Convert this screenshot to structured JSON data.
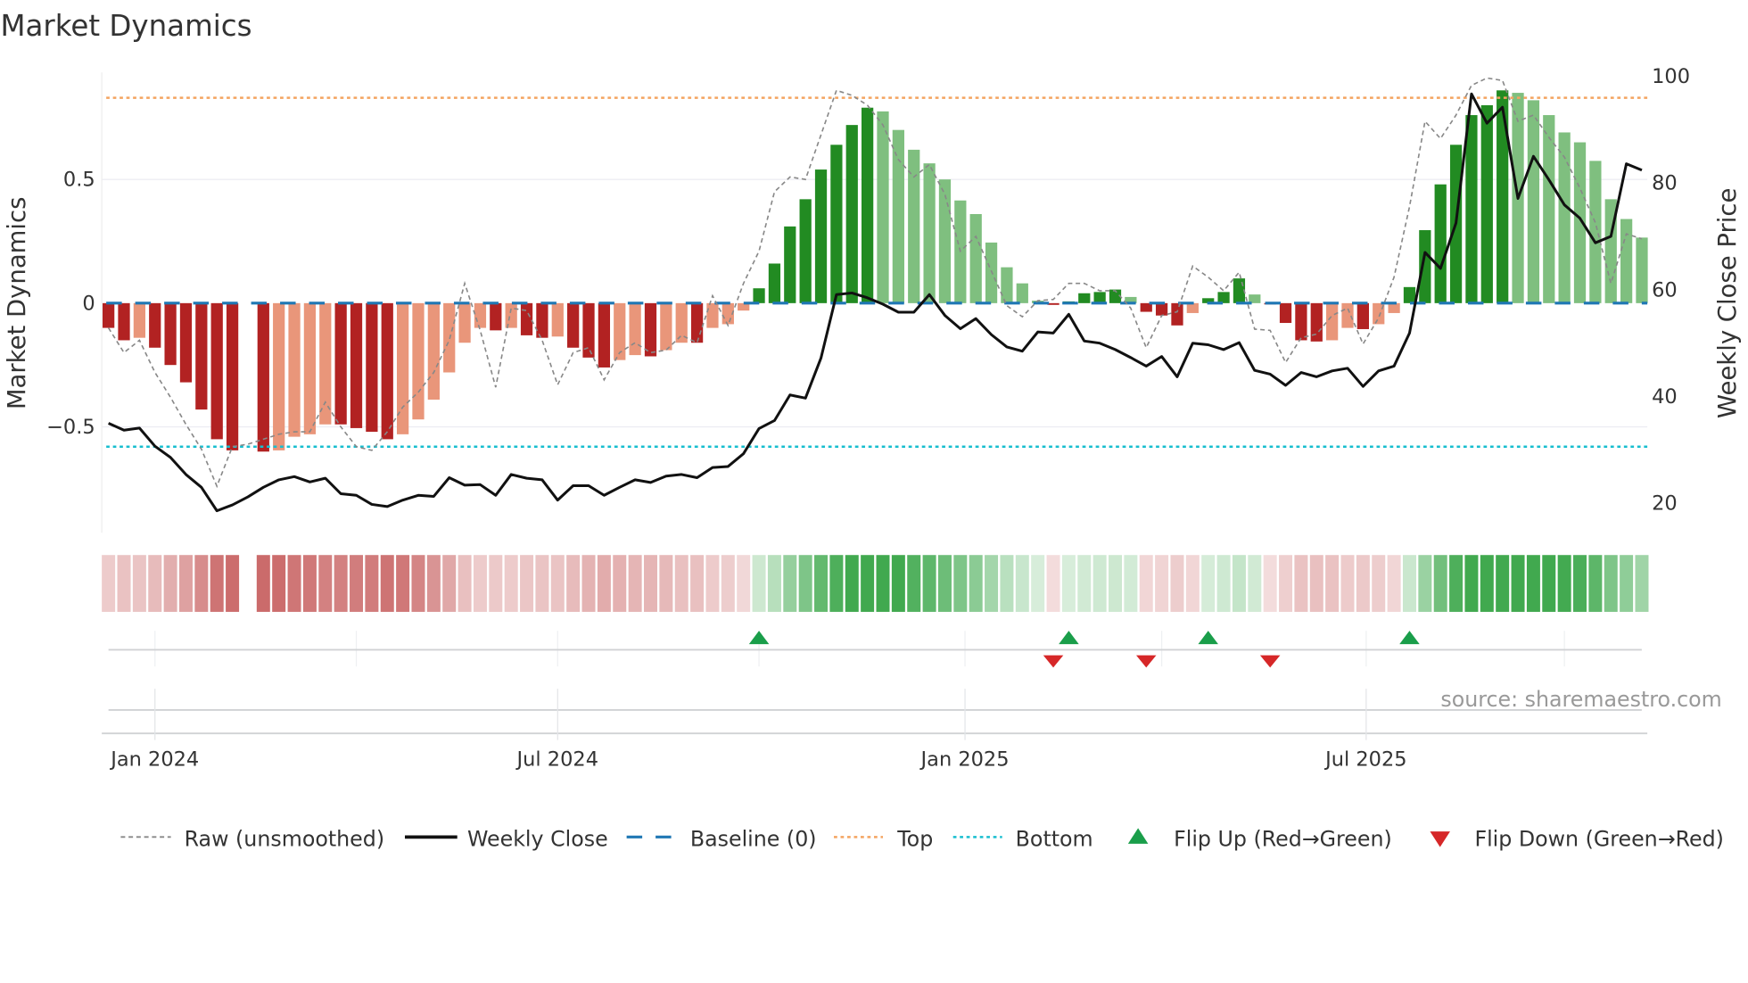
{
  "chart_data": {
    "type": "bar",
    "title": "Market Dynamics",
    "ylabel": "Market Dynamics",
    "y2label": "Weekly Close Price",
    "ylim": [
      -0.93,
      0.93
    ],
    "y2lim": [
      16,
      104
    ],
    "yticks": [
      {
        "v": 0.5,
        "label": "0.5"
      },
      {
        "v": 0,
        "label": "0"
      },
      {
        "v": -0.5,
        "label": "−0.5"
      }
    ],
    "y2ticks": [
      {
        "v": 100,
        "label": "100"
      },
      {
        "v": 80,
        "label": "80"
      },
      {
        "v": 60,
        "label": "60"
      },
      {
        "v": 40,
        "label": "40"
      },
      {
        "v": 20,
        "label": "20"
      }
    ],
    "xticks": [
      {
        "week": 3,
        "label": "Jan 2024"
      },
      {
        "week": 29,
        "label": "Jul 2024"
      },
      {
        "week": 55.3,
        "label": "Jan 2025"
      },
      {
        "week": 81.2,
        "label": "Jul 2025"
      }
    ],
    "minor_xticks": [
      16,
      42,
      68,
      94
    ],
    "weeks": 100,
    "top_level": 0.83,
    "bottom_level": -0.58,
    "baseline": 0,
    "colors": {
      "dark_red": "#b22222",
      "light_red": "#e9967a",
      "dark_green": "#228b22",
      "light_green": "#7fbf7f",
      "raw": "#888888",
      "close": "#111111",
      "baseline": "#1f77b4",
      "top": "#f4a460",
      "bottom": "#17becf",
      "flip_up": "#1a9e4a",
      "flip_down": "#d62728"
    },
    "dynamics": [
      -0.1,
      -0.15,
      -0.14,
      -0.18,
      -0.25,
      -0.32,
      -0.43,
      -0.55,
      -0.595,
      null,
      -0.6,
      -0.595,
      -0.54,
      -0.53,
      -0.49,
      -0.49,
      -0.505,
      -0.52,
      -0.55,
      -0.53,
      -0.47,
      -0.39,
      -0.28,
      -0.16,
      -0.1,
      -0.11,
      -0.1,
      -0.13,
      -0.14,
      -0.135,
      -0.18,
      -0.22,
      -0.26,
      -0.23,
      -0.21,
      -0.215,
      -0.19,
      -0.16,
      -0.16,
      -0.1,
      -0.085,
      -0.03,
      0.06,
      0.16,
      0.31,
      0.42,
      0.54,
      0.64,
      0.72,
      0.79,
      0.775,
      0.7,
      0.62,
      0.565,
      0.5,
      0.415,
      0.36,
      0.245,
      0.145,
      0.08,
      0.01,
      -0.007,
      0.007,
      0.04,
      0.045,
      0.055,
      0.025,
      -0.035,
      -0.05,
      -0.09,
      -0.04,
      0.02,
      0.045,
      0.1,
      0.035,
      -0.005,
      -0.08,
      -0.15,
      -0.155,
      -0.15,
      -0.1,
      -0.105,
      -0.085,
      -0.04,
      0.065,
      0.295,
      0.48,
      0.64,
      0.76,
      0.8,
      0.86,
      0.85,
      0.82,
      0.76,
      0.69,
      0.65,
      0.575,
      0.42,
      0.34,
      0.265
    ],
    "strength": [
      "strong",
      "strong",
      "weak",
      "strong",
      "strong",
      "strong",
      "strong",
      "strong",
      "strong",
      null,
      "strong",
      "weak",
      "weak",
      "weak",
      "weak",
      "strong",
      "strong",
      "strong",
      "strong",
      "weak",
      "weak",
      "weak",
      "weak",
      "weak",
      "weak",
      "strong",
      "weak",
      "strong",
      "strong",
      "weak",
      "strong",
      "strong",
      "strong",
      "weak",
      "weak",
      "strong",
      "weak",
      "weak",
      "strong",
      "weak",
      "weak",
      "weak",
      "strong",
      "strong",
      "strong",
      "strong",
      "strong",
      "strong",
      "strong",
      "strong",
      "weak",
      "weak",
      "weak",
      "weak",
      "weak",
      "weak",
      "weak",
      "weak",
      "weak",
      "weak",
      "weak",
      "strong",
      "strong",
      "strong",
      "strong",
      "strong",
      "weak",
      "strong",
      "strong",
      "strong",
      "weak",
      "strong",
      "strong",
      "strong",
      "weak",
      "strong",
      "strong",
      "strong",
      "strong",
      "weak",
      "weak",
      "strong",
      "weak",
      "weak",
      "strong",
      "strong",
      "strong",
      "strong",
      "strong",
      "strong",
      "strong",
      "weak",
      "weak",
      "weak",
      "weak",
      "weak",
      "weak",
      "weak",
      "weak",
      "weak"
    ],
    "weekly_close": [
      35.0,
      33.7,
      34.1,
      30.7,
      28.6,
      25.4,
      23.0,
      18.6,
      19.7,
      21.2,
      23.0,
      24.4,
      25.0,
      24.0,
      24.7,
      21.8,
      21.5,
      19.8,
      19.4,
      20.6,
      21.5,
      21.3,
      24.8,
      23.4,
      23.5,
      21.5,
      25.4,
      24.7,
      24.4,
      20.6,
      23.3,
      23.3,
      21.5,
      23.0,
      24.4,
      23.9,
      25.1,
      25.4,
      24.8,
      26.7,
      26.9,
      29.3,
      34.0,
      35.5,
      40.3,
      39.7,
      47.2,
      59.1,
      59.4,
      58.5,
      57.3,
      55.8,
      55.8,
      59.1,
      55.2,
      52.7,
      54.6,
      51.6,
      49.3,
      48.5,
      52.1,
      51.9,
      55.4,
      50.4,
      50.0,
      48.8,
      47.3,
      45.7,
      47.5,
      43.7,
      50.0,
      49.7,
      48.8,
      50.1,
      44.9,
      44.2,
      42.1,
      44.5,
      43.7,
      44.8,
      45.3,
      41.9,
      44.8,
      45.7,
      51.9,
      67.0,
      64.0,
      72.5,
      96.7,
      91.2,
      94.2,
      77.1,
      85.0,
      80.6,
      75.9,
      73.4,
      68.8,
      70.0,
      83.6,
      82.4
    ],
    "raw": [
      -0.1,
      -0.2,
      -0.15,
      -0.28,
      -0.38,
      -0.49,
      -0.59,
      -0.74,
      -0.58,
      -0.57,
      -0.55,
      -0.53,
      -0.52,
      -0.52,
      -0.4,
      -0.5,
      -0.58,
      -0.595,
      -0.52,
      -0.42,
      -0.36,
      -0.28,
      -0.15,
      0.08,
      -0.11,
      -0.34,
      -0.02,
      -0.03,
      -0.15,
      -0.33,
      -0.2,
      -0.18,
      -0.31,
      -0.2,
      -0.16,
      -0.2,
      -0.19,
      -0.13,
      -0.16,
      0.03,
      -0.09,
      0.08,
      0.21,
      0.45,
      0.51,
      0.5,
      0.68,
      0.86,
      0.84,
      0.8,
      0.72,
      0.58,
      0.51,
      0.56,
      0.44,
      0.21,
      0.27,
      0.13,
      -0.01,
      -0.055,
      0.01,
      0.015,
      0.08,
      0.08,
      0.05,
      0.05,
      -0.02,
      -0.18,
      -0.05,
      -0.035,
      0.15,
      0.105,
      0.05,
      0.125,
      -0.105,
      -0.11,
      -0.24,
      -0.14,
      -0.125,
      -0.05,
      -0.02,
      -0.165,
      -0.06,
      0.105,
      0.39,
      0.735,
      0.665,
      0.76,
      0.88,
      0.91,
      0.9,
      0.735,
      0.76,
      0.67,
      0.59,
      0.465,
      0.325,
      0.08,
      0.28,
      0.26
    ],
    "flip_up_weeks": [
      42,
      62,
      71,
      84
    ],
    "flip_down_weeks": [
      61,
      67,
      75
    ],
    "legend": {
      "placement": "bottom",
      "raw": "Raw (unsmoothed)",
      "close": "Weekly Close",
      "baseline": "Baseline (0)",
      "top": "Top",
      "bottom": "Bottom",
      "flip_up": "Flip Up (Red→Green)",
      "flip_down": "Flip Down (Green→Red)"
    },
    "source": "source: sharemaestro.com"
  }
}
